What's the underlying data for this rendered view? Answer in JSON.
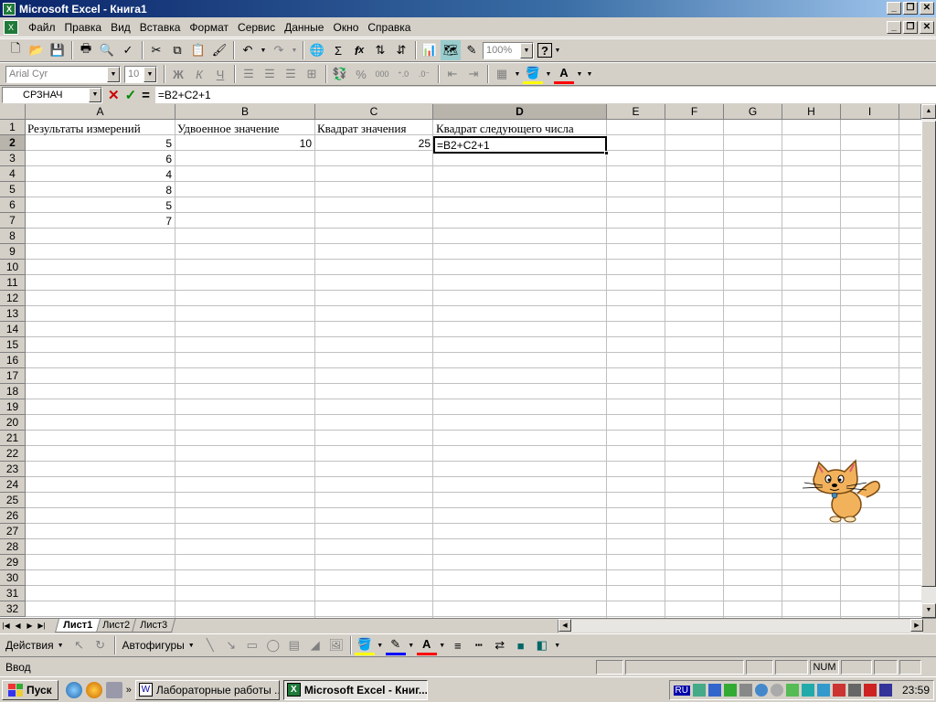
{
  "window": {
    "title": "Microsoft Excel - Книга1",
    "icon": "excel-icon"
  },
  "menu": [
    "Файл",
    "Правка",
    "Вид",
    "Вставка",
    "Формат",
    "Сервис",
    "Данные",
    "Окно",
    "Справка"
  ],
  "toolbar": {
    "zoom": "100%",
    "font_name": "Arial Cyr",
    "font_size": "10"
  },
  "formula_bar": {
    "name_box": "СРЗНАЧ",
    "cancel": "✕",
    "enter": "✓",
    "equals": "=",
    "formula": "=B2+C2+1"
  },
  "columns": [
    "A",
    "B",
    "C",
    "D",
    "E",
    "F",
    "G",
    "H",
    "I"
  ],
  "selected_column": "D",
  "rows": [
    "1",
    "2",
    "3",
    "4",
    "5",
    "6",
    "7",
    "8",
    "9",
    "10",
    "11",
    "12",
    "13",
    "14",
    "15",
    "16",
    "17",
    "18",
    "19",
    "20",
    "21",
    "22",
    "23",
    "24",
    "25",
    "26",
    "27",
    "28",
    "29",
    "30",
    "31",
    "32"
  ],
  "selected_row": "2",
  "cells": {
    "A1": "Результаты измерений",
    "B1": "Удвоенное значение",
    "C1": "Квадрат значения",
    "D1": "Квадрат следующего числа",
    "A2": "5",
    "B2": "10",
    "C2": "25",
    "D2": "=B2+C2+1",
    "A3": "6",
    "A4": "4",
    "A5": "8",
    "A6": "5",
    "A7": "7"
  },
  "sheet_tabs": [
    "Лист1",
    "Лист2",
    "Лист3"
  ],
  "active_sheet": "Лист1",
  "draw_toolbar": {
    "actions": "Действия",
    "autoshapes": "Автофигуры"
  },
  "status": {
    "mode": "Ввод",
    "num": "NUM"
  },
  "taskbar": {
    "start": "Пуск",
    "tasks": [
      "Лабораторные работы ...",
      "Microsoft Excel - Книг..."
    ],
    "lang": "RU",
    "time": "23:59"
  },
  "colors": {
    "title_start": "#0a246a",
    "title_end": "#a6caf0",
    "excel_green": "#1f7a3a",
    "chrome": "#d4d0c8"
  }
}
